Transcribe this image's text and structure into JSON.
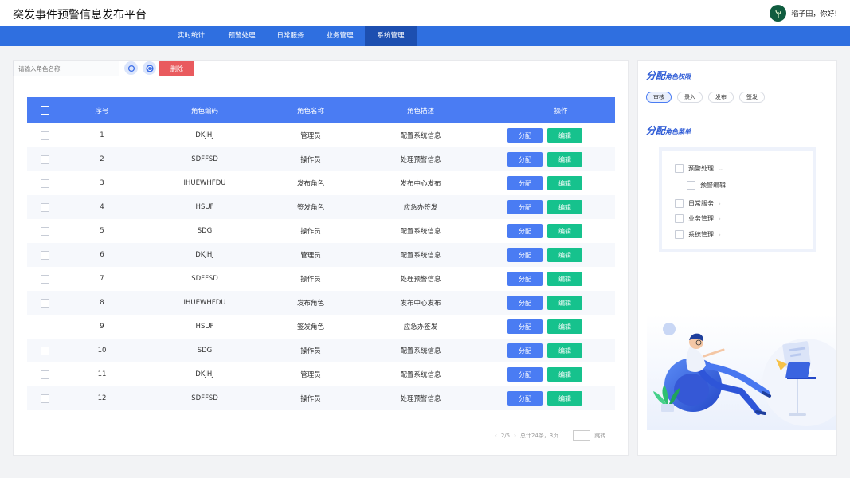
{
  "header": {
    "title": "突发事件预警信息发布平台",
    "user_greeting": "稻子田，你好!"
  },
  "nav": {
    "items": [
      {
        "label": "实时统计"
      },
      {
        "label": "预警处理"
      },
      {
        "label": "日常服务"
      },
      {
        "label": "业务管理"
      },
      {
        "label": "系统管理",
        "active": true
      }
    ]
  },
  "toolbar": {
    "search_placeholder": "请输入角色名称",
    "search_icon": "search-icon",
    "refresh_icon": "refresh-icon",
    "delete_label": "删除"
  },
  "table": {
    "columns": [
      "序号",
      "角色编码",
      "角色名称",
      "角色描述",
      "操作"
    ],
    "assign_label": "分配",
    "edit_label": "编辑",
    "rows": [
      {
        "no": "1",
        "code": "DKJHJ",
        "name": "管理员",
        "desc": "配置系统信息"
      },
      {
        "no": "2",
        "code": "SDFFSD",
        "name": "操作员",
        "desc": "处理预警信息"
      },
      {
        "no": "3",
        "code": "IHUEWHFDU",
        "name": "发布角色",
        "desc": "发布中心发布"
      },
      {
        "no": "4",
        "code": "HSUF",
        "name": "签发角色",
        "desc": "应急办签发"
      },
      {
        "no": "5",
        "code": "SDG",
        "name": "操作员",
        "desc": "配置系统信息"
      },
      {
        "no": "6",
        "code": "DKJHJ",
        "name": "管理员",
        "desc": "配置系统信息"
      },
      {
        "no": "7",
        "code": "SDFFSD",
        "name": "操作员",
        "desc": "处理预警信息"
      },
      {
        "no": "8",
        "code": "IHUEWHFDU",
        "name": "发布角色",
        "desc": "发布中心发布"
      },
      {
        "no": "9",
        "code": "HSUF",
        "name": "签发角色",
        "desc": "应急办签发"
      },
      {
        "no": "10",
        "code": "SDG",
        "name": "操作员",
        "desc": "配置系统信息"
      },
      {
        "no": "11",
        "code": "DKJHJ",
        "name": "管理员",
        "desc": "配置系统信息"
      },
      {
        "no": "12",
        "code": "SDFFSD",
        "name": "操作员",
        "desc": "处理预警信息"
      }
    ]
  },
  "pagination": {
    "page": "2/5",
    "total": "总计24条，3页",
    "jump_label": "跳转"
  },
  "permissions": {
    "title_main": "分配",
    "title_sub": "角色权限",
    "chips": [
      {
        "label": "审核",
        "active": true
      },
      {
        "label": "录入"
      },
      {
        "label": "发布"
      },
      {
        "label": "签发"
      }
    ]
  },
  "menus": {
    "title_main": "分配",
    "title_sub": "角色菜单",
    "items": [
      {
        "label": "预警处理",
        "expanded": true
      },
      {
        "label": "预警编辑",
        "child": true
      },
      {
        "label": "日常服务"
      },
      {
        "label": "业务管理"
      },
      {
        "label": "系统管理"
      }
    ]
  },
  "colors": {
    "primary": "#4a7cf3",
    "nav": "#2f6fe0",
    "nav_active": "#1d4fb0",
    "danger": "#e95a5e",
    "success": "#16c28d"
  }
}
